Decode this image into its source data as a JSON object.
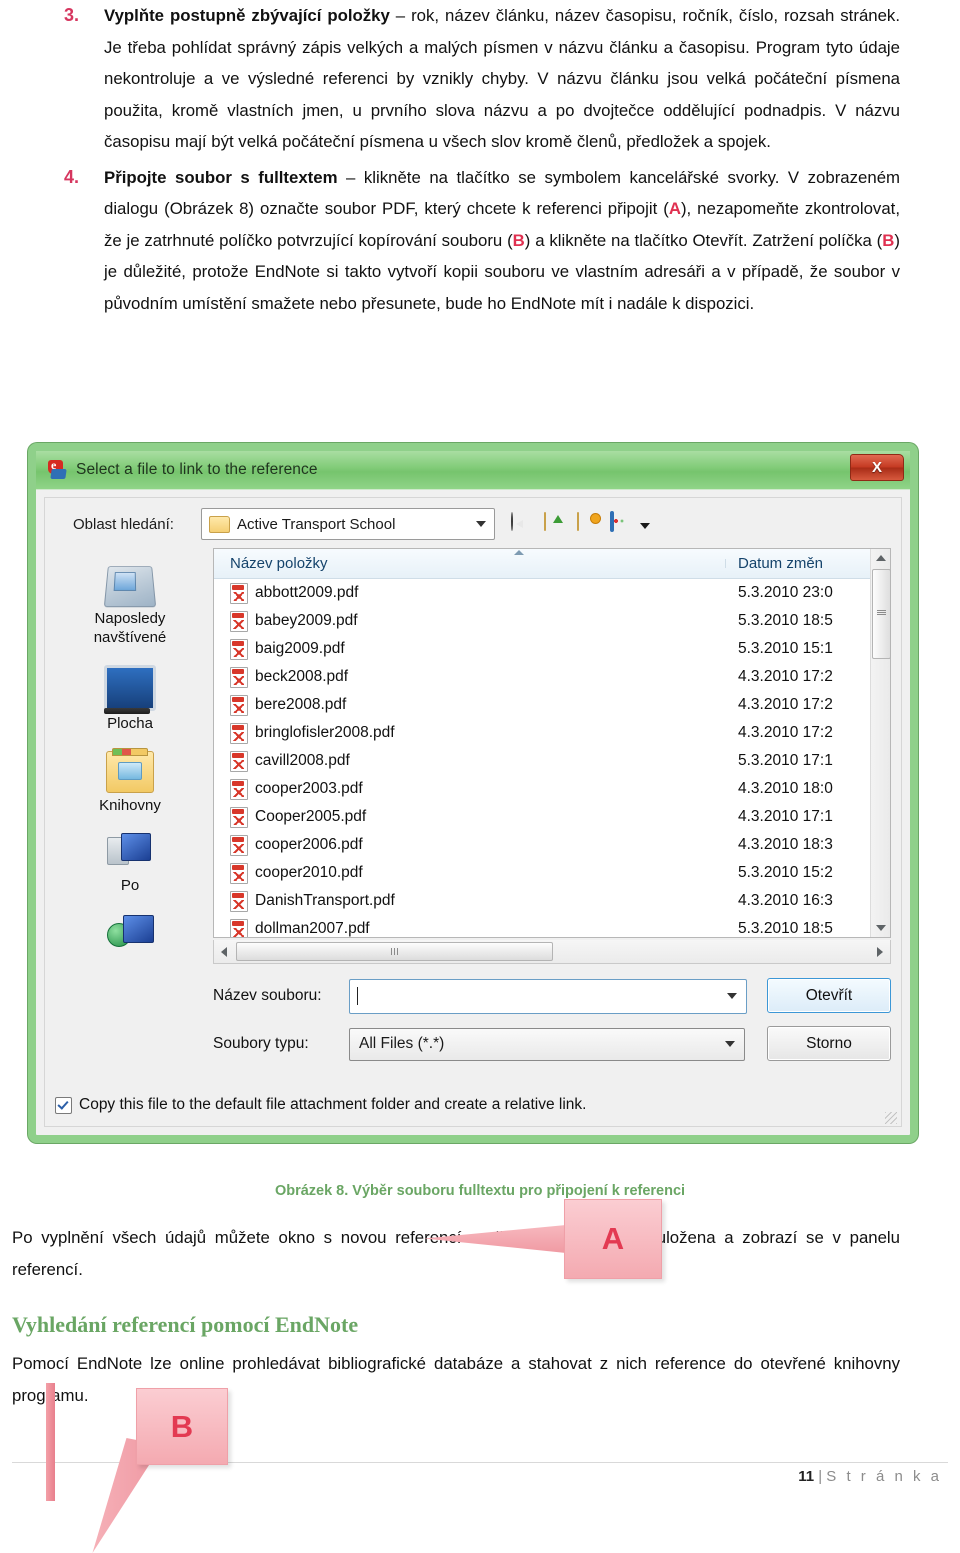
{
  "document": {
    "list_items": [
      {
        "number": "3.",
        "lead": "Vyplňte postupně zbývající položky",
        "rest": " – rok, název článku, název časopisu, ročník, číslo, rozsah stránek. Je třeba pohlídat správný zápis velkých a malých písmen v názvu článku a časopisu. Program tyto údaje nekontroluje a ve výsledné referenci by vznikly chyby. V názvu článku jsou velká počáteční písmena použita, kromě vlastních jmen, u prvního slova názvu a po dvojtečce oddělující podnadpis. V názvu časopisu mají být velká počáteční písmena u všech slov kromě členů, předložek a spojek."
      },
      {
        "number": "4.",
        "lead": "Připojte soubor s fulltextem",
        "rest_1": " – klikněte na tlačítko se symbolem kancelářské svorky. V zobrazeném dialogu (Obrázek 8) označte soubor PDF, který chcete k referenci připojit (",
        "mark_a": "A",
        "rest_2": "), nezapomeňte zkontrolovat, že je zatrhnuté políčko potvrzující kopírování souboru (",
        "mark_b1": "B",
        "rest_3": ") a klikněte na tlačítko Otevřít. Zatržení políčka (",
        "mark_b2": "B",
        "rest_4": ") je důležité, protože EndNote si takto vytvoří kopii souboru ve vlastním adresáři a v případě, že soubor v původním umístění smažete nebo přesunete, bude ho EndNote mít i nadále k dispozici."
      }
    ],
    "figure_caption": "Obrázek 8. Výběr souboru fulltextu pro připojení k referenci",
    "after_paragraph": "Po vyplnění všech údajů můžete okno s novou referencí zavřít. Reference bude uložena a zobrazí se v panelu referencí.",
    "section_heading": "Vyhledání referencí pomocí EndNote",
    "section_paragraph": "Pomocí EndNote lze online prohledávat bibliografické databáze a stahovat z nich reference do otevřené knihovny programu.",
    "footer": {
      "page_number": "11",
      "separator": "|",
      "label": "S t r á n k a"
    }
  },
  "dialog": {
    "title": "Select a file to link to the reference",
    "close_label": "X",
    "lookin": {
      "label": "Oblast hledání:",
      "value": "Active Transport School"
    },
    "toolbar": {
      "back": "back-icon",
      "up": "up-folder-icon",
      "newfolder": "new-folder-icon",
      "views": "views-icon"
    },
    "places": [
      {
        "label_line1": "Naposledy",
        "label_line2": "navštívené",
        "icon": "recent-places-icon"
      },
      {
        "label_line1": "Plocha",
        "label_line2": "",
        "icon": "desktop-icon"
      },
      {
        "label_line1": "Knihovny",
        "label_line2": "",
        "icon": "libraries-icon"
      },
      {
        "label_line1": "Po",
        "label_line2": "",
        "icon": "computer-icon"
      },
      {
        "label_line1": "",
        "label_line2": "",
        "icon": "network-icon"
      }
    ],
    "columns": {
      "name": "Název položky",
      "modified": "Datum změn"
    },
    "files": [
      {
        "name": "abbott2009.pdf",
        "modified": "5.3.2010 23:0"
      },
      {
        "name": "babey2009.pdf",
        "modified": "5.3.2010 18:5"
      },
      {
        "name": "baig2009.pdf",
        "modified": "5.3.2010 15:1"
      },
      {
        "name": "beck2008.pdf",
        "modified": "4.3.2010 17:2"
      },
      {
        "name": "bere2008.pdf",
        "modified": "4.3.2010 17:2"
      },
      {
        "name": "bringlofisler2008.pdf",
        "modified": "4.3.2010 17:2"
      },
      {
        "name": "cavill2008.pdf",
        "modified": "5.3.2010 17:1"
      },
      {
        "name": "cooper2003.pdf",
        "modified": "4.3.2010 18:0"
      },
      {
        "name": "Cooper2005.pdf",
        "modified": "4.3.2010 17:1"
      },
      {
        "name": "cooper2006.pdf",
        "modified": "4.3.2010 18:3"
      },
      {
        "name": "cooper2010.pdf",
        "modified": "5.3.2010 15:2"
      },
      {
        "name": "DanishTransport.pdf",
        "modified": "4.3.2010 16:3"
      },
      {
        "name": "dollman2007.pdf",
        "modified": "5.3.2010 18:5"
      }
    ],
    "filename": {
      "label": "Název souboru:",
      "value": ""
    },
    "filetype": {
      "label": "Soubory typu:",
      "value": "All Files (*.*)"
    },
    "buttons": {
      "open": "Otevřít",
      "cancel": "Storno"
    },
    "copy_checkbox": {
      "label": "Copy this file to the default file attachment folder and create a relative link.",
      "checked": true
    }
  },
  "callouts": {
    "a": "A",
    "b": "B"
  },
  "colors": {
    "accent_red": "#d6365f",
    "marker_red": "#e03050",
    "title_green": "#7ecb74",
    "heading_green": "#6aa664",
    "callout_pink": "#f4aab1",
    "callout_letter": "#e33a52"
  }
}
